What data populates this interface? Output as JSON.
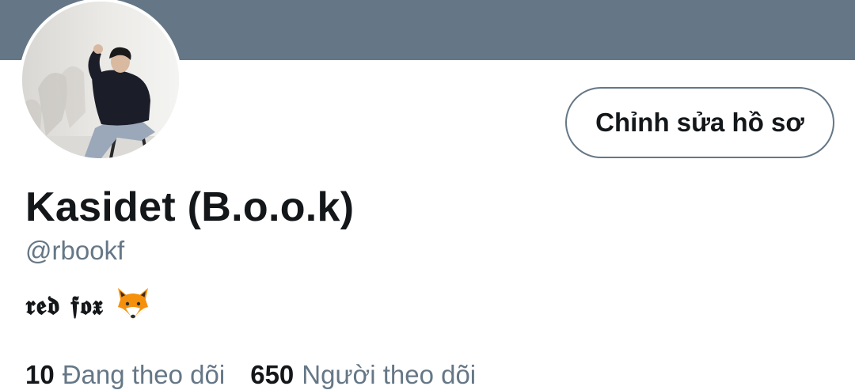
{
  "profile": {
    "display_name": "Kasidet (B.o.o.k)",
    "handle": "@rbookf",
    "bio": "𝖗𝖊𝖉 𝖋𝖔𝖝",
    "bio_emoji": "fox-face-icon",
    "edit_button_label": "Chỉnh sửa hồ sơ"
  },
  "stats": {
    "following_count": "10",
    "following_label": "Đang theo dõi",
    "followers_count": "650",
    "followers_label": "Người theo dõi"
  },
  "colors": {
    "banner": "#657786",
    "text_primary": "#14171a",
    "text_secondary": "#657786",
    "button_border": "#657786",
    "fox_orange": "#f4900c"
  }
}
